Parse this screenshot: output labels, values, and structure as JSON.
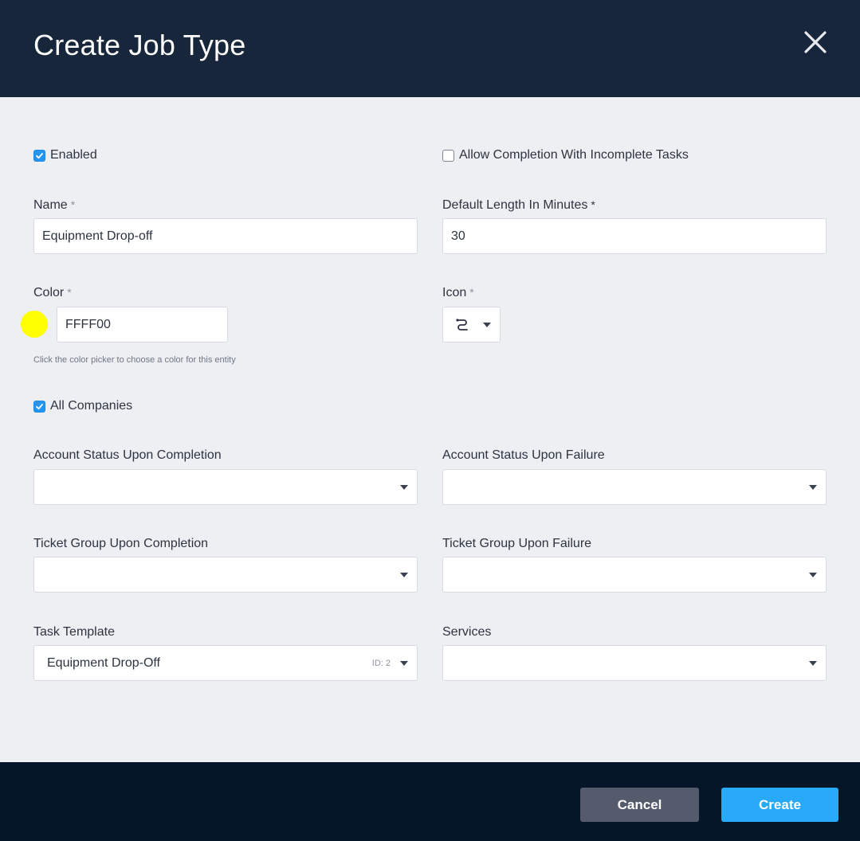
{
  "dialog": {
    "title": "Create Job Type"
  },
  "enabled": {
    "label": "Enabled",
    "checked": true
  },
  "allow_incomplete": {
    "label": "Allow Completion With Incomplete Tasks",
    "checked": false
  },
  "name": {
    "label": "Name",
    "required_mark": "*",
    "value": "Equipment Drop-off"
  },
  "default_length": {
    "label": "Default Length In Minutes",
    "required_mark": "*",
    "value": "30"
  },
  "color": {
    "label": "Color",
    "required_mark": "*",
    "value": "FFFF00",
    "swatch": "#FFFF00",
    "hint": "Click the color picker to choose a color for this entity"
  },
  "icon": {
    "label": "Icon",
    "required_mark": "*",
    "selected_icon": "route-icon"
  },
  "all_companies": {
    "label": "All Companies",
    "checked": true
  },
  "account_status_completion": {
    "label": "Account Status Upon Completion",
    "value": ""
  },
  "account_status_failure": {
    "label": "Account Status Upon Failure",
    "value": ""
  },
  "ticket_group_completion": {
    "label": "Ticket Group Upon Completion",
    "value": ""
  },
  "ticket_group_failure": {
    "label": "Ticket Group Upon Failure",
    "value": ""
  },
  "task_template": {
    "label": "Task Template",
    "value": "Equipment Drop-Off",
    "id_tag": "ID: 2"
  },
  "services": {
    "label": "Services",
    "value": ""
  },
  "footer": {
    "cancel_label": "Cancel",
    "create_label": "Create"
  },
  "colors": {
    "header_bg": "#17263A",
    "footer_bg": "#041627",
    "primary": "#29AAF8",
    "secondary": "#545B6D",
    "checkbox": "#2196F3"
  }
}
